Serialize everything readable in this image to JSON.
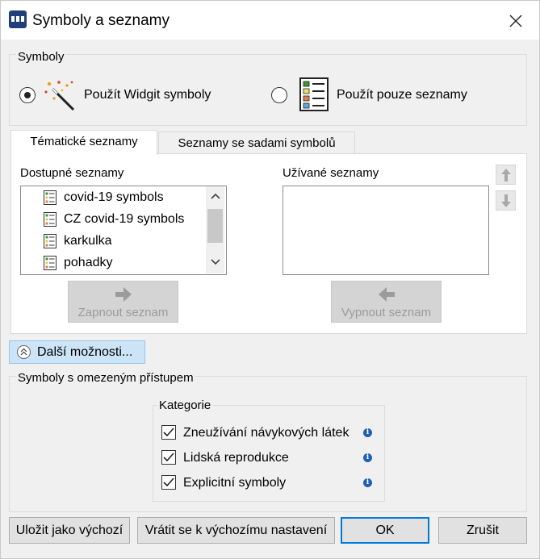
{
  "window": {
    "title": "Symboly a seznamy",
    "icon": "app-icon",
    "close_icon": "close-icon"
  },
  "symbols_group": {
    "label": "Symboly",
    "options": [
      {
        "label": "Použít Widgit symboly",
        "selected": true,
        "icon": "magic-wand-icon"
      },
      {
        "label": "Použít pouze seznamy",
        "selected": false,
        "icon": "list-icon"
      }
    ]
  },
  "tabs": [
    {
      "label": "Tématické seznamy",
      "active": true
    },
    {
      "label": "Seznamy se sadami symbolů",
      "active": false
    }
  ],
  "available_lists": {
    "label": "Dostupné seznamy",
    "items": [
      "covid-19 symbols",
      "CZ covid-19 symbols",
      "karkulka",
      "pohadky"
    ],
    "enable_button": "Zapnout seznam"
  },
  "used_lists": {
    "label": "Užívané seznamy",
    "items": [],
    "disable_button": "Vypnout seznam"
  },
  "more_options": {
    "label": "Další možnosti..."
  },
  "restricted_group": {
    "label": "Symboly s omezeným přístupem",
    "category_label": "Kategorie",
    "categories": [
      {
        "label": "Zneužívání návykových látek",
        "checked": true
      },
      {
        "label": "Lidská reprodukce",
        "checked": true
      },
      {
        "label": "Explicitní symboly",
        "checked": true
      }
    ]
  },
  "footer": {
    "save_default": "Uložit jako výchozí",
    "restore_default": "Vrátit se k výchozímu nastavení",
    "ok": "OK",
    "cancel": "Zrušit"
  },
  "colors": {
    "accent": "#0078d7",
    "more_button_bg": "#cce4f7",
    "disabled_button_bg": "#d4d4d4"
  }
}
